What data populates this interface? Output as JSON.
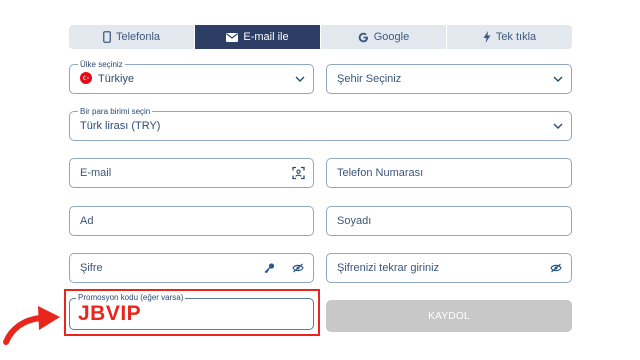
{
  "tabs": [
    {
      "label": "Telefonla",
      "icon": "phone-icon",
      "active": false
    },
    {
      "label": "E-mail ile",
      "icon": "envelope-icon",
      "active": true
    },
    {
      "label": "Google",
      "icon": "google-icon",
      "active": false
    },
    {
      "label": "Tek tıkla",
      "icon": "lightning-icon",
      "active": false
    }
  ],
  "form": {
    "country": {
      "label": "Ülke seçiniz",
      "value": "Türkiye"
    },
    "city": {
      "placeholder": "Şehir Seçiniz"
    },
    "currency": {
      "label": "Bir para birimi seçin",
      "value": "Türk lirası (TRY)"
    },
    "email": {
      "placeholder": "E-mail"
    },
    "phone": {
      "placeholder": "Telefon Numarası"
    },
    "first_name": {
      "placeholder": "Ad"
    },
    "last_name": {
      "placeholder": "Soyadı"
    },
    "password": {
      "placeholder": "Şifre"
    },
    "password_repeat": {
      "placeholder": "Şifrenizi tekrar giriniz"
    },
    "promo": {
      "label": "Promosyon kodu (eğer varsa)",
      "value": "JBVIP"
    },
    "submit_label": "KAYDOL"
  },
  "colors": {
    "tab_active": "#2c3e66",
    "tab_bg": "#e3e8ef",
    "field_border": "#8fa6c4",
    "highlight": "#e8261c",
    "submit_disabled": "#c8c8c8"
  }
}
